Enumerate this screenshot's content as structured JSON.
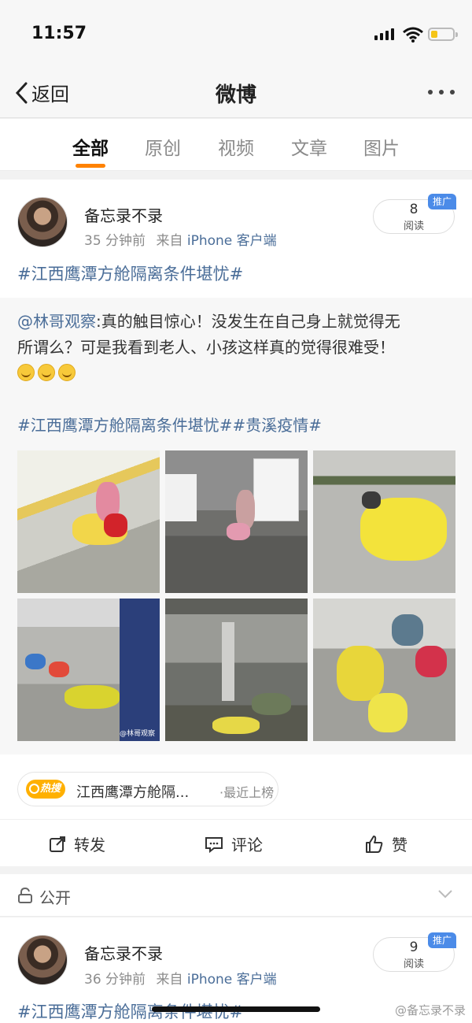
{
  "status": {
    "time": "11:57"
  },
  "nav": {
    "back_label": "返回",
    "title": "微博"
  },
  "tabs": [
    {
      "label": "全部",
      "active": true
    },
    {
      "label": "原创"
    },
    {
      "label": "视频"
    },
    {
      "label": "文章"
    },
    {
      "label": "图片"
    }
  ],
  "post1": {
    "username": "备忘录不录",
    "time": "35 分钟前",
    "source_prefix": "来自",
    "source": "iPhone 客户端",
    "read_count": "8",
    "read_label": "阅读",
    "promo_badge": "推广",
    "hashtag": "#江西鹰潭方舱隔离条件堪忧#",
    "repost": {
      "mention": "@林哥观察",
      "text_line1": ":真的触目惊心！没发生在自己身上就觉得无",
      "text_line2": "所谓么？可是我看到老人、小孩这样真的觉得很难受！",
      "emojis": [
        "crying-emoji",
        "crying-emoji",
        "crying-emoji"
      ],
      "tags": "#江西鹰潭方舱隔离条件堪忧##贵溪疫情#",
      "photo_watermark": "@林哥观察"
    },
    "hot_search": {
      "badge": "热搜",
      "text": "江西鹰潭方舱隔...",
      "suffix": "·最近上榜"
    },
    "actions": {
      "repost": "转发",
      "comment": "评论",
      "like": "赞"
    }
  },
  "visibility": {
    "label": "公开"
  },
  "post2": {
    "username": "备忘录不录",
    "time": "36 分钟前",
    "source_prefix": "来自",
    "source": "iPhone 客户端",
    "read_count": "9",
    "read_label": "阅读",
    "promo_badge": "推广",
    "hashtag": "#江西鹰潭方舱隔离条件堪忧#"
  },
  "watermark": "@备忘录不录",
  "colors": {
    "accent": "#ff8200",
    "link": "#4a6d98",
    "promo": "#4b8be8",
    "hot": "#ffb000"
  }
}
